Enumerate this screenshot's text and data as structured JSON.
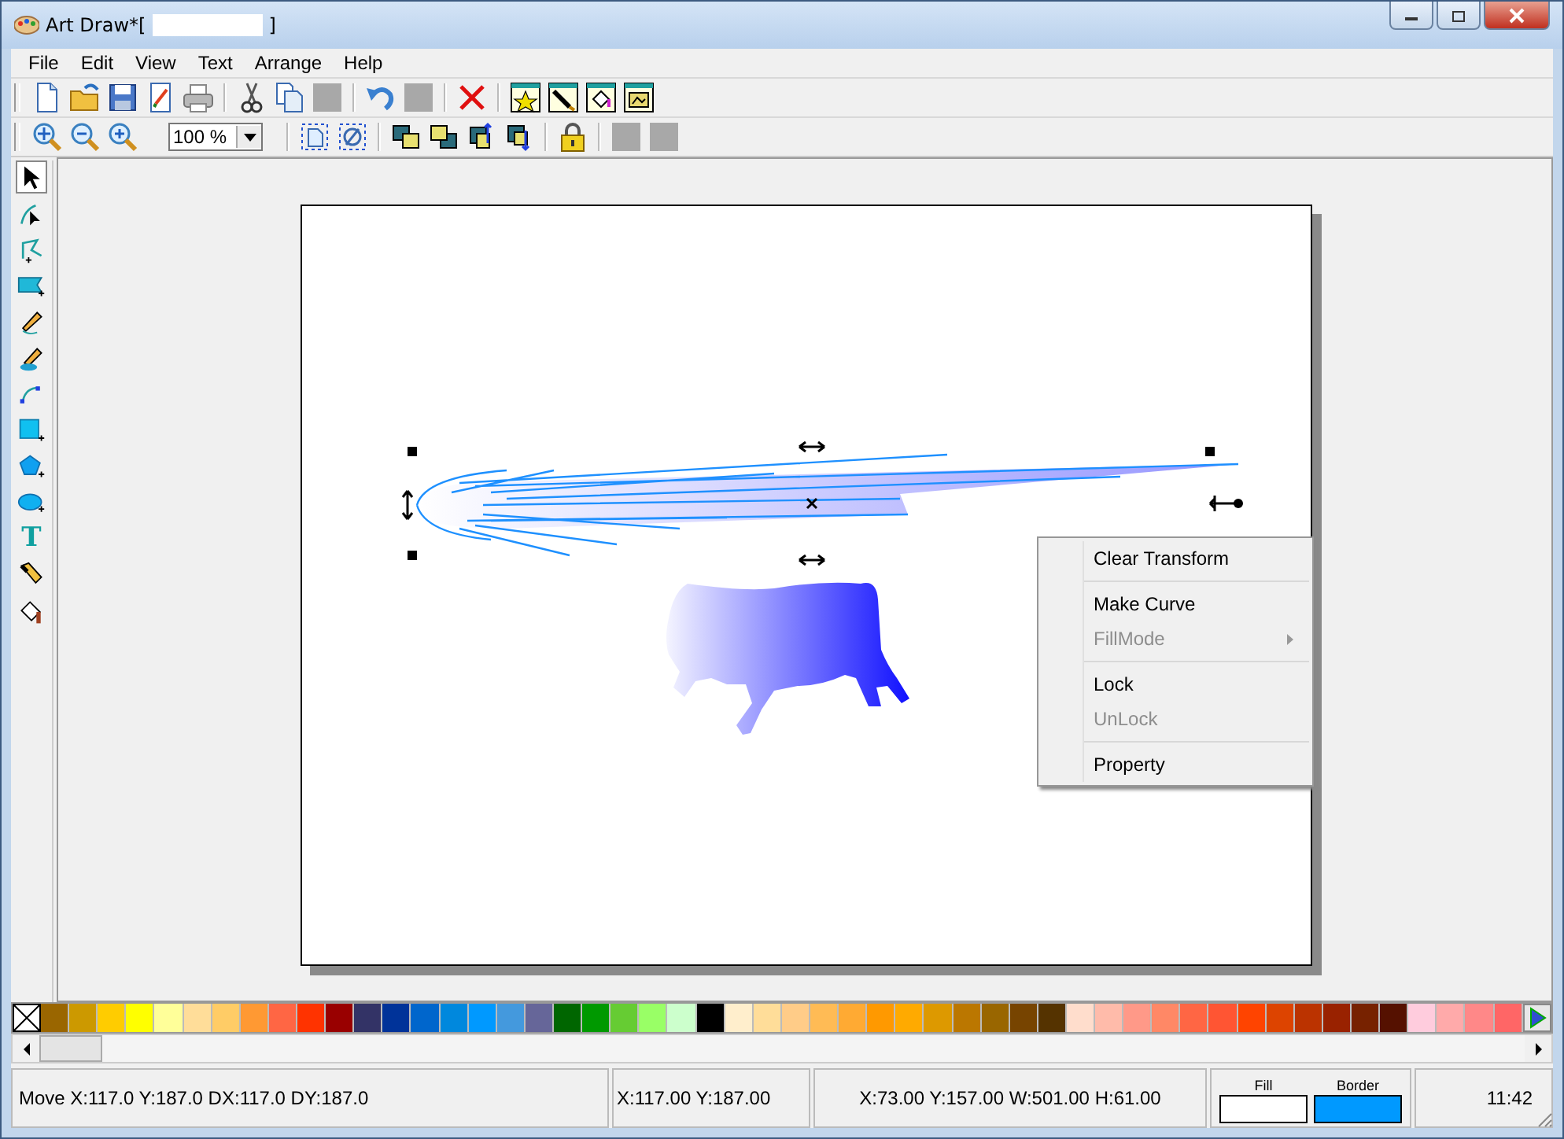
{
  "window": {
    "title": "Art Draw*[",
    "title_end": "]"
  },
  "menu": [
    "File",
    "Edit",
    "View",
    "Text",
    "Arrange",
    "Help"
  ],
  "toolbar_1": [
    {
      "kind": "new"
    },
    {
      "kind": "open"
    },
    {
      "kind": "save"
    },
    {
      "kind": "preview"
    },
    {
      "kind": "print"
    },
    {
      "kind": "sep"
    },
    {
      "kind": "cut"
    },
    {
      "kind": "copy"
    },
    {
      "kind": "blank"
    },
    {
      "kind": "sep"
    },
    {
      "kind": "undo"
    },
    {
      "kind": "blank"
    },
    {
      "kind": "sep"
    },
    {
      "kind": "delete"
    },
    {
      "kind": "sep"
    },
    {
      "kind": "star"
    },
    {
      "kind": "brush"
    },
    {
      "kind": "bucket"
    },
    {
      "kind": "picture"
    }
  ],
  "toolbar_2": [
    {
      "kind": "zoom-fit"
    },
    {
      "kind": "zoom-out"
    },
    {
      "kind": "zoom-in"
    },
    {
      "kind": "zoom-combo",
      "value": "100 %"
    },
    {
      "kind": "sep"
    },
    {
      "kind": "select-all"
    },
    {
      "kind": "deselect"
    },
    {
      "kind": "sep"
    },
    {
      "kind": "to-front"
    },
    {
      "kind": "to-back"
    },
    {
      "kind": "forward"
    },
    {
      "kind": "backward"
    },
    {
      "kind": "sep"
    },
    {
      "kind": "lock"
    },
    {
      "kind": "sep"
    },
    {
      "kind": "blank"
    },
    {
      "kind": "blank"
    }
  ],
  "toolbox": [
    {
      "kind": "pointer",
      "selected": true
    },
    {
      "kind": "node",
      "selected": false
    },
    {
      "kind": "polyline",
      "selected": false
    },
    {
      "kind": "banner",
      "selected": false
    },
    {
      "kind": "pencil",
      "selected": false
    },
    {
      "kind": "brush",
      "selected": false
    },
    {
      "kind": "arc",
      "selected": false
    },
    {
      "kind": "rectangle",
      "selected": false
    },
    {
      "kind": "pentagon",
      "selected": false
    },
    {
      "kind": "ellipse",
      "selected": false
    },
    {
      "kind": "text",
      "value": "T",
      "selected": false
    },
    {
      "kind": "pen",
      "selected": false
    },
    {
      "kind": "bucket",
      "selected": false
    }
  ],
  "context_menu": [
    {
      "label": "Clear Transform",
      "disabled": false
    },
    {
      "kind": "sep"
    },
    {
      "label": "Make Curve",
      "disabled": false
    },
    {
      "label": "FillMode",
      "disabled": true,
      "submenu": true
    },
    {
      "kind": "sep"
    },
    {
      "label": "Lock",
      "disabled": false
    },
    {
      "label": "UnLock",
      "disabled": true
    },
    {
      "kind": "sep"
    },
    {
      "label": "Property",
      "disabled": false
    }
  ],
  "palette": [
    {
      "color": "#9a6600"
    },
    {
      "color": "#cc9900"
    },
    {
      "color": "#ffcc00"
    },
    {
      "color": "#ffff00"
    },
    {
      "color": "#ffff99"
    },
    {
      "color": "#ffdd99"
    },
    {
      "color": "#ffcc66"
    },
    {
      "color": "#ff9933"
    },
    {
      "color": "#ff6644"
    },
    {
      "color": "#ff3300"
    },
    {
      "color": "#990000"
    },
    {
      "color": "#333366"
    },
    {
      "color": "#003399"
    },
    {
      "color": "#0066cc"
    },
    {
      "color": "#0088dd"
    },
    {
      "color": "#0099ff"
    },
    {
      "color": "#4499dd"
    },
    {
      "color": "#666699"
    },
    {
      "color": "#006600"
    },
    {
      "color": "#009900"
    },
    {
      "color": "#66cc33"
    },
    {
      "color": "#99ff66"
    },
    {
      "color": "#ccffcc"
    },
    {
      "color": "#000000"
    },
    {
      "color": "#ffeecc"
    },
    {
      "color": "#ffdd99"
    },
    {
      "color": "#ffcc88"
    },
    {
      "color": "#ffbb55"
    },
    {
      "color": "#ffaa33"
    },
    {
      "color": "#ff9900"
    },
    {
      "color": "#ffaa00"
    },
    {
      "color": "#dd9900"
    },
    {
      "color": "#bb7700"
    },
    {
      "color": "#996600"
    },
    {
      "color": "#774400"
    },
    {
      "color": "#553300"
    },
    {
      "color": "#ffddcc"
    },
    {
      "color": "#ffbbaa"
    },
    {
      "color": "#ff9988"
    },
    {
      "color": "#ff8866"
    },
    {
      "color": "#ff6644"
    },
    {
      "color": "#ff5533"
    },
    {
      "color": "#ff4400"
    },
    {
      "color": "#dd4400"
    },
    {
      "color": "#bb3300"
    },
    {
      "color": "#992200"
    },
    {
      "color": "#772200"
    },
    {
      "color": "#551100"
    },
    {
      "color": "#ffccdd"
    },
    {
      "color": "#ffaaaa"
    },
    {
      "color": "#ff8888"
    },
    {
      "color": "#ff6666"
    }
  ],
  "status_bar": {
    "message": "Move X:117.0 Y:187.0 DX:117.0 DY:187.0",
    "cursor": "X:117.00 Y:187.00",
    "selection": "X:73.00 Y:157.00  W:501.00   H:61.00",
    "swatches": [
      {
        "label": "Fill",
        "color": "#ffffff"
      },
      {
        "label": "Border",
        "color": "#0099ff"
      }
    ],
    "time": "11:42"
  }
}
